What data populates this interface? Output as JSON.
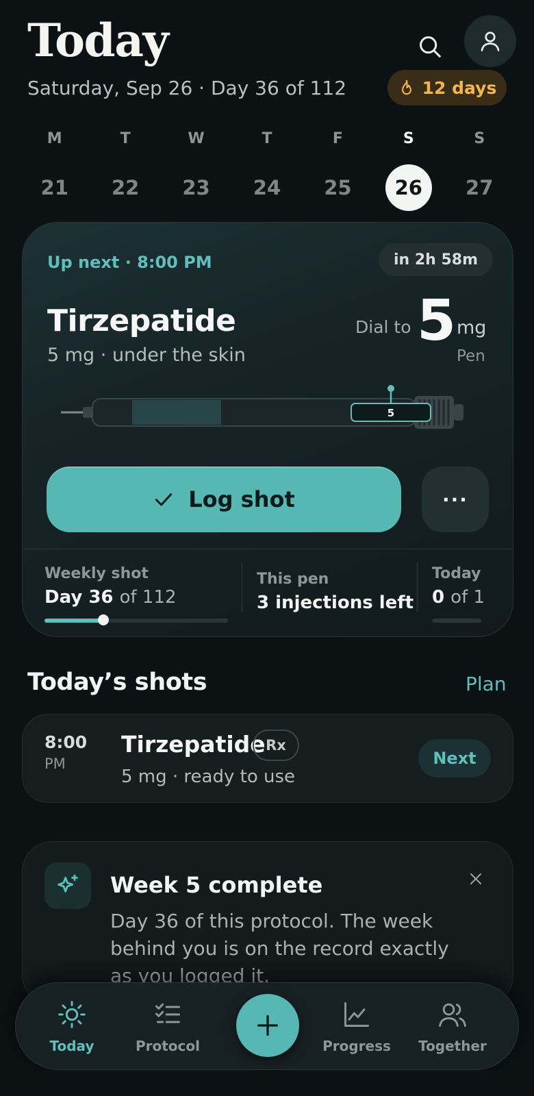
{
  "header": {
    "title": "Today",
    "date_line": "Saturday, Sep 26 · Day 36 of 112",
    "streak": "12 days",
    "icons": [
      "search-icon",
      "profile-icon",
      "flame-icon"
    ]
  },
  "week": {
    "days": [
      {
        "letter": "M",
        "num": "21"
      },
      {
        "letter": "T",
        "num": "22"
      },
      {
        "letter": "W",
        "num": "23"
      },
      {
        "letter": "T",
        "num": "24"
      },
      {
        "letter": "F",
        "num": "25"
      },
      {
        "letter": "S",
        "num": "26"
      },
      {
        "letter": "S",
        "num": "27"
      }
    ],
    "selected_index": 5
  },
  "up_next": {
    "label": "Up next · 8:00 PM",
    "countdown": "in 2h 58m",
    "med_name": "Tirzepatide",
    "med_detail": "5 mg · under the skin",
    "dial_label": "Dial to",
    "dial_value": "5",
    "dial_unit": "mg",
    "device": "Pen",
    "pen_window_value": "5",
    "log_button": "Log shot",
    "more_button": "···",
    "stats": {
      "weekly_label": "Weekly shot",
      "weekly_day": "Day 36",
      "weekly_of": "of 112",
      "weekly_progress": 0.32,
      "pen_label": "This pen",
      "pen_value": "3 injections left",
      "today_label": "Today",
      "today_count": "0",
      "today_of": "of 1"
    }
  },
  "todays_shots": {
    "title": "Today’s shots",
    "plan_link": "Plan",
    "items": [
      {
        "time": "8:00",
        "ampm": "PM",
        "name": "Tirzepatide",
        "badge": "Rx",
        "detail": "5 mg · ready to use",
        "action": "Next"
      }
    ]
  },
  "milestone": {
    "title": "Week 5 complete",
    "body": "Day 36 of this protocol. The week behind you is on the record exactly as you logged it."
  },
  "nav": {
    "items": [
      {
        "label": "Today",
        "icon": "sun-icon"
      },
      {
        "label": "Protocol",
        "icon": "checklist-icon"
      },
      {
        "label": "Progress",
        "icon": "chart-icon"
      },
      {
        "label": "Together",
        "icon": "people-icon"
      }
    ],
    "fab_icon": "plus-icon",
    "active": "Today"
  },
  "colors": {
    "background": "#0c1113",
    "accent": "#57b7b3",
    "streak": "#f1b552"
  }
}
